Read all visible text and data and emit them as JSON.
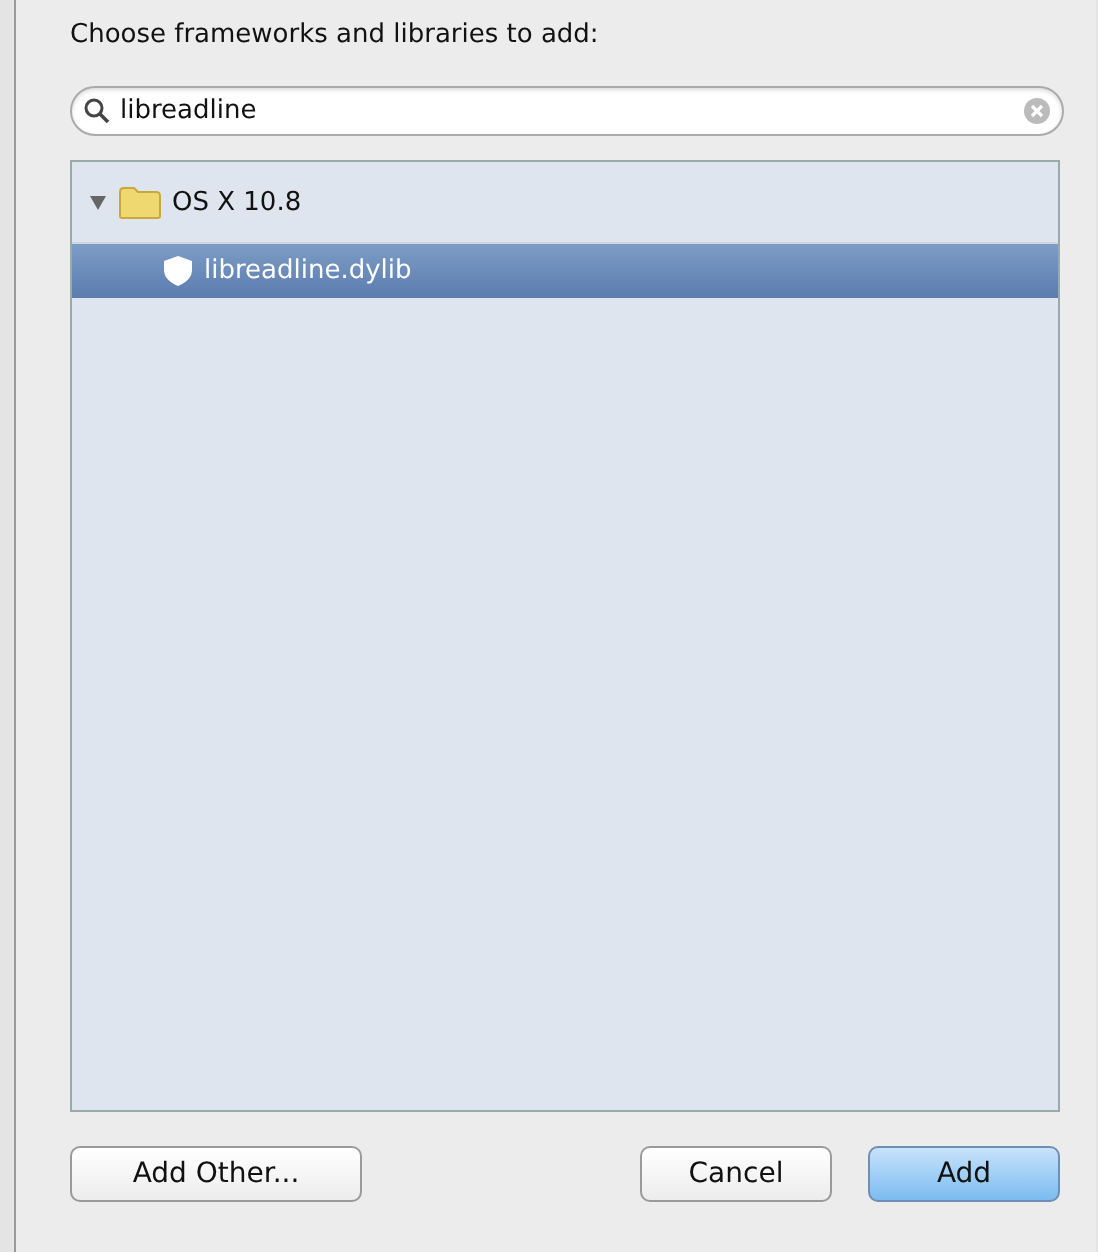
{
  "title": "Choose frameworks and libraries to add:",
  "search": {
    "value": "libreadline"
  },
  "tree": [
    {
      "label": "OS X 10.8",
      "kind": "folder",
      "expanded": true,
      "selected": false,
      "children": [
        {
          "label": "libreadline.dylib",
          "kind": "library",
          "selected": true
        }
      ]
    }
  ],
  "buttons": [
    {
      "label": "Add Other...",
      "kind": "normal"
    },
    {
      "label": "Cancel",
      "kind": "normal"
    },
    {
      "label": "Add",
      "kind": "default"
    }
  ]
}
